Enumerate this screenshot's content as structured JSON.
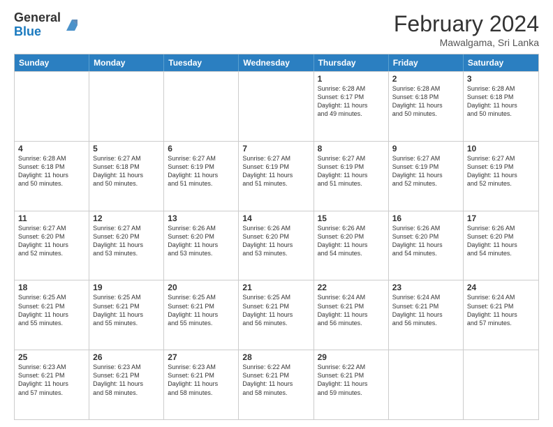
{
  "logo": {
    "general": "General",
    "blue": "Blue"
  },
  "title": "February 2024",
  "subtitle": "Mawalgama, Sri Lanka",
  "days": [
    "Sunday",
    "Monday",
    "Tuesday",
    "Wednesday",
    "Thursday",
    "Friday",
    "Saturday"
  ],
  "rows": [
    [
      {
        "day": "",
        "info": ""
      },
      {
        "day": "",
        "info": ""
      },
      {
        "day": "",
        "info": ""
      },
      {
        "day": "",
        "info": ""
      },
      {
        "day": "1",
        "info": "Sunrise: 6:28 AM\nSunset: 6:17 PM\nDaylight: 11 hours\nand 49 minutes."
      },
      {
        "day": "2",
        "info": "Sunrise: 6:28 AM\nSunset: 6:18 PM\nDaylight: 11 hours\nand 50 minutes."
      },
      {
        "day": "3",
        "info": "Sunrise: 6:28 AM\nSunset: 6:18 PM\nDaylight: 11 hours\nand 50 minutes."
      }
    ],
    [
      {
        "day": "4",
        "info": "Sunrise: 6:28 AM\nSunset: 6:18 PM\nDaylight: 11 hours\nand 50 minutes."
      },
      {
        "day": "5",
        "info": "Sunrise: 6:27 AM\nSunset: 6:18 PM\nDaylight: 11 hours\nand 50 minutes."
      },
      {
        "day": "6",
        "info": "Sunrise: 6:27 AM\nSunset: 6:19 PM\nDaylight: 11 hours\nand 51 minutes."
      },
      {
        "day": "7",
        "info": "Sunrise: 6:27 AM\nSunset: 6:19 PM\nDaylight: 11 hours\nand 51 minutes."
      },
      {
        "day": "8",
        "info": "Sunrise: 6:27 AM\nSunset: 6:19 PM\nDaylight: 11 hours\nand 51 minutes."
      },
      {
        "day": "9",
        "info": "Sunrise: 6:27 AM\nSunset: 6:19 PM\nDaylight: 11 hours\nand 52 minutes."
      },
      {
        "day": "10",
        "info": "Sunrise: 6:27 AM\nSunset: 6:19 PM\nDaylight: 11 hours\nand 52 minutes."
      }
    ],
    [
      {
        "day": "11",
        "info": "Sunrise: 6:27 AM\nSunset: 6:20 PM\nDaylight: 11 hours\nand 52 minutes."
      },
      {
        "day": "12",
        "info": "Sunrise: 6:27 AM\nSunset: 6:20 PM\nDaylight: 11 hours\nand 53 minutes."
      },
      {
        "day": "13",
        "info": "Sunrise: 6:26 AM\nSunset: 6:20 PM\nDaylight: 11 hours\nand 53 minutes."
      },
      {
        "day": "14",
        "info": "Sunrise: 6:26 AM\nSunset: 6:20 PM\nDaylight: 11 hours\nand 53 minutes."
      },
      {
        "day": "15",
        "info": "Sunrise: 6:26 AM\nSunset: 6:20 PM\nDaylight: 11 hours\nand 54 minutes."
      },
      {
        "day": "16",
        "info": "Sunrise: 6:26 AM\nSunset: 6:20 PM\nDaylight: 11 hours\nand 54 minutes."
      },
      {
        "day": "17",
        "info": "Sunrise: 6:26 AM\nSunset: 6:20 PM\nDaylight: 11 hours\nand 54 minutes."
      }
    ],
    [
      {
        "day": "18",
        "info": "Sunrise: 6:25 AM\nSunset: 6:21 PM\nDaylight: 11 hours\nand 55 minutes."
      },
      {
        "day": "19",
        "info": "Sunrise: 6:25 AM\nSunset: 6:21 PM\nDaylight: 11 hours\nand 55 minutes."
      },
      {
        "day": "20",
        "info": "Sunrise: 6:25 AM\nSunset: 6:21 PM\nDaylight: 11 hours\nand 55 minutes."
      },
      {
        "day": "21",
        "info": "Sunrise: 6:25 AM\nSunset: 6:21 PM\nDaylight: 11 hours\nand 56 minutes."
      },
      {
        "day": "22",
        "info": "Sunrise: 6:24 AM\nSunset: 6:21 PM\nDaylight: 11 hours\nand 56 minutes."
      },
      {
        "day": "23",
        "info": "Sunrise: 6:24 AM\nSunset: 6:21 PM\nDaylight: 11 hours\nand 56 minutes."
      },
      {
        "day": "24",
        "info": "Sunrise: 6:24 AM\nSunset: 6:21 PM\nDaylight: 11 hours\nand 57 minutes."
      }
    ],
    [
      {
        "day": "25",
        "info": "Sunrise: 6:23 AM\nSunset: 6:21 PM\nDaylight: 11 hours\nand 57 minutes."
      },
      {
        "day": "26",
        "info": "Sunrise: 6:23 AM\nSunset: 6:21 PM\nDaylight: 11 hours\nand 58 minutes."
      },
      {
        "day": "27",
        "info": "Sunrise: 6:23 AM\nSunset: 6:21 PM\nDaylight: 11 hours\nand 58 minutes."
      },
      {
        "day": "28",
        "info": "Sunrise: 6:22 AM\nSunset: 6:21 PM\nDaylight: 11 hours\nand 58 minutes."
      },
      {
        "day": "29",
        "info": "Sunrise: 6:22 AM\nSunset: 6:21 PM\nDaylight: 11 hours\nand 59 minutes."
      },
      {
        "day": "",
        "info": ""
      },
      {
        "day": "",
        "info": ""
      }
    ]
  ]
}
